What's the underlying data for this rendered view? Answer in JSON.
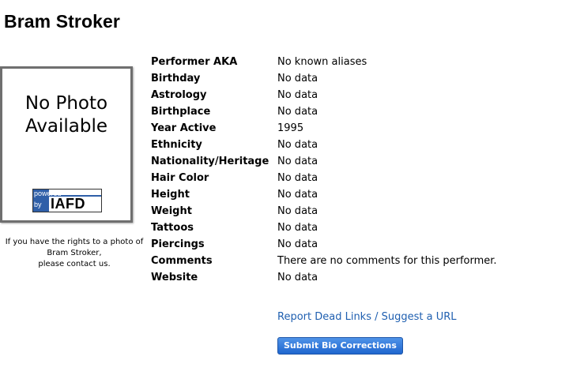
{
  "performer": {
    "name": "Bram Stroker"
  },
  "photo": {
    "placeholder_line1": "No Photo",
    "placeholder_line2": "Available",
    "badge_powered": "powered",
    "badge_by": "by",
    "badge_logo": "IAFD",
    "note_line1": "If you have the rights to a photo of",
    "note_line2": "Bram Stroker,",
    "note_line3": "please contact us."
  },
  "bio": [
    {
      "label": "Performer AKA",
      "value": "No known aliases"
    },
    {
      "label": "Birthday",
      "value": "No data"
    },
    {
      "label": "Astrology",
      "value": "No data"
    },
    {
      "label": "Birthplace",
      "value": "No data"
    },
    {
      "label": "Year Active",
      "value": "1995"
    },
    {
      "label": "Ethnicity",
      "value": "No data"
    },
    {
      "label": "Nationality/Heritage",
      "value": "No data"
    },
    {
      "label": "Hair Color",
      "value": "No data"
    },
    {
      "label": "Height",
      "value": "No data"
    },
    {
      "label": "Weight",
      "value": "No data"
    },
    {
      "label": "Tattoos",
      "value": "No data"
    },
    {
      "label": "Piercings",
      "value": "No data"
    },
    {
      "label": "Comments",
      "value": "There are no comments for this performer."
    },
    {
      "label": "Website",
      "value": "No data"
    }
  ],
  "actions": {
    "report_link": "Report Dead Links / Suggest a URL",
    "submit_button": "Submit Bio Corrections"
  },
  "colors": {
    "link": "#1f5fb0",
    "button": "#2a6fd6",
    "badge_blue": "#2f5fa8"
  }
}
